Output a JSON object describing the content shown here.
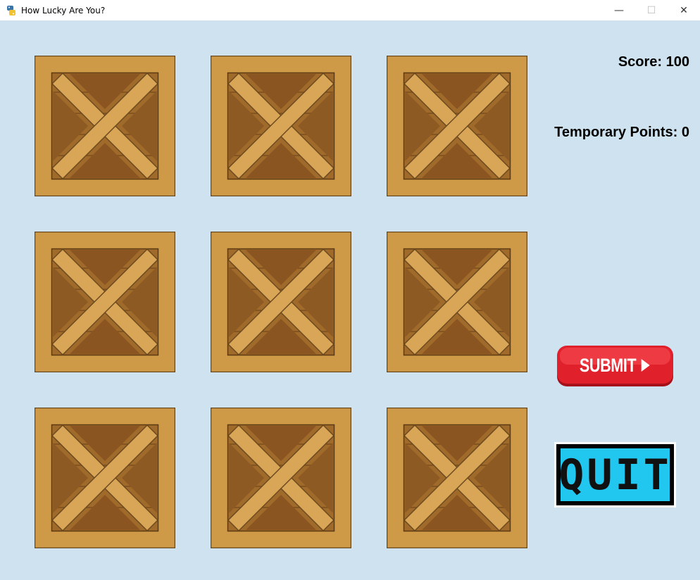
{
  "window": {
    "title": "How Lucky Are You?",
    "minimize_glyph": "—",
    "maximize_glyph": "☐",
    "close_glyph": "✕",
    "app_icon": "python-snake-icon"
  },
  "scoreboard": {
    "score_text": "Score: 100",
    "temp_points_text": "Temporary Points: 0"
  },
  "crates": [
    {
      "label": "crate-1"
    },
    {
      "label": "crate-2"
    },
    {
      "label": "crate-3"
    },
    {
      "label": "crate-4"
    },
    {
      "label": "crate-5"
    },
    {
      "label": "crate-6"
    },
    {
      "label": "crate-7"
    },
    {
      "label": "crate-8"
    },
    {
      "label": "crate-9"
    }
  ],
  "buttons": {
    "submit_label": "SUBMIT",
    "quit_label": "QUIT"
  },
  "colors": {
    "background": "#cfe2f0",
    "crate_frame": "#cf9a48",
    "crate_inner": "#a06a2a",
    "submit_red": "#e0202a",
    "quit_cyan": "#22c7f0"
  }
}
